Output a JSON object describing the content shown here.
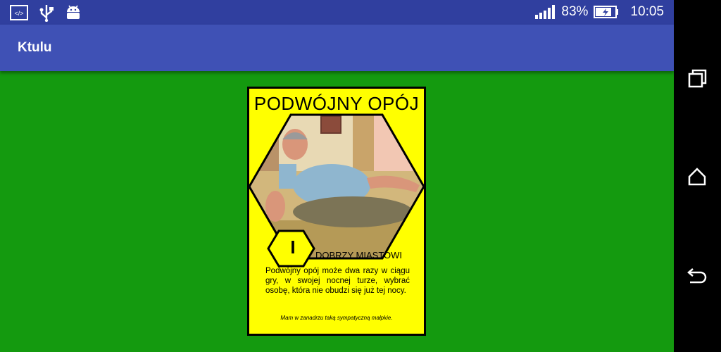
{
  "status_bar": {
    "battery_percent": "83%",
    "time": "10:05",
    "icons": [
      "code-icon",
      "usb-icon",
      "android-icon",
      "signal-icon",
      "battery-charging-icon"
    ]
  },
  "app_bar": {
    "title": "Ktulu"
  },
  "card": {
    "title": "PODWÓJNY OPÓJ",
    "level": "I",
    "faction": "DOBRZY MIASTOWI",
    "description": "Podwójny opój może dwa razy w ciągu gry, w swojej nocnej turze, wybrać osobę, która nie obudzi się już tej nocy.",
    "quote": "Mam w zanadrzu taką sympatyczną małpkie.",
    "colors": {
      "card_bg": "#ffff00",
      "border": "#000000",
      "screen_bg": "#149a0f"
    }
  },
  "nav_bar": {
    "icons": [
      "recents-icon",
      "home-icon",
      "back-icon"
    ]
  }
}
